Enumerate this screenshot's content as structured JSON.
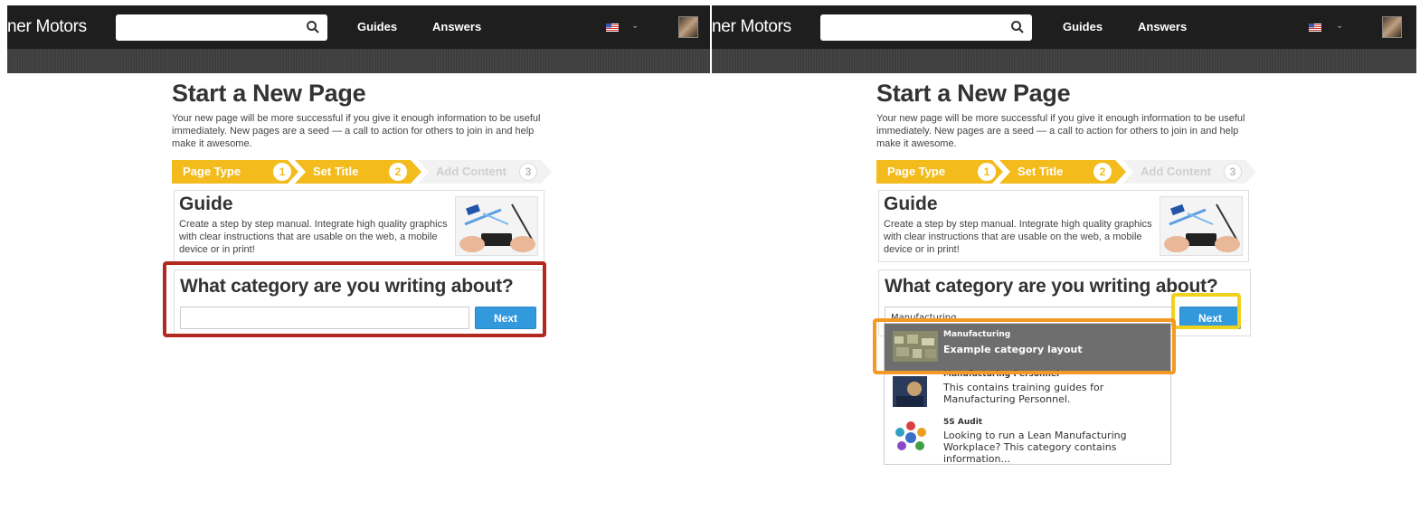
{
  "header": {
    "brand": "ner Motors",
    "nav_guides": "Guides",
    "nav_answers": "Answers",
    "search_value": ""
  },
  "page": {
    "title": "Start a New Page",
    "intro": "Your new page will be more successful if you give it enough information to be useful immediately. New pages are a seed — a call to action for others to join in and help make it awesome."
  },
  "steps": [
    {
      "label": "Page Type",
      "number": "1"
    },
    {
      "label": "Set Title",
      "number": "2"
    },
    {
      "label": "Add Content",
      "number": "3"
    }
  ],
  "guide": {
    "title": "Guide",
    "description": "Create a step by step manual. Integrate high quality graphics with clear instructions that are usable on the web, a mobile device or in print!"
  },
  "category": {
    "question": "What category are you writing about?",
    "input_value_left": "",
    "input_value_right": "Manufacturing",
    "next_label": "Next"
  },
  "dropdown": [
    {
      "title": "Manufacturing",
      "description": "Example category layout",
      "selected": true
    },
    {
      "title": "Manufacturing Personnel",
      "description": "This contains training guides for Manufacturing Personnel.",
      "selected": false
    },
    {
      "title": "5S Audit",
      "description": "Looking to run a Lean Manufacturing Workplace? This category contains information...",
      "selected": false
    }
  ],
  "colors": {
    "step_active": "#f3bb1c",
    "next_button": "#3399dd",
    "highlight_red": "#b3291f",
    "highlight_yellow": "#f0d21c",
    "highlight_orange": "#f29a23"
  }
}
